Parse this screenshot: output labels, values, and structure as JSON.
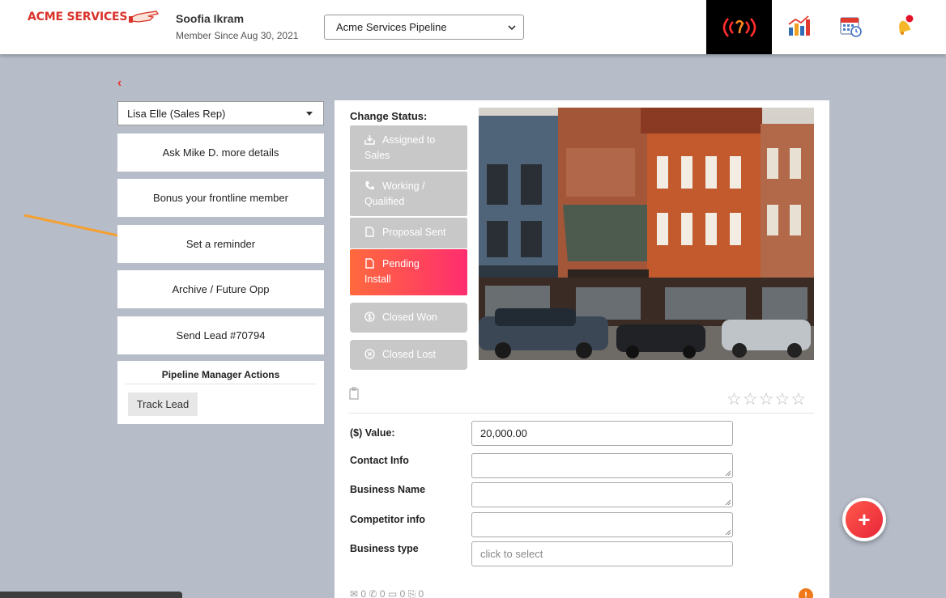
{
  "app": {
    "logo_text": "ACME SERVICES"
  },
  "user": {
    "name": "Soofia Ikram",
    "member_since": "Member Since Aug 30, 2021"
  },
  "pipeline": {
    "selected": "Acme Services Pipeline"
  },
  "header_icons": [
    "live-broadcast-icon",
    "analytics-chart-icon",
    "calendar-icon",
    "notification-bell-icon"
  ],
  "back_label": "‹",
  "rep": {
    "selected": "Lisa Elle (Sales Rep)"
  },
  "actions": [
    "Ask Mike D. more details",
    "Bonus your frontline member",
    "Set a reminder",
    "Archive / Future Opp",
    "Send Lead #70794"
  ],
  "pipeline_manager": {
    "title": "Pipeline Manager Actions",
    "track_label": "Track Lead"
  },
  "status": {
    "title": "Change Status:",
    "options": [
      {
        "line1": "Assigned to",
        "line2": "Sales"
      },
      {
        "line1": "Working /",
        "line2": "Qualified"
      },
      {
        "line1": "Proposal Sent",
        "line2": ""
      },
      {
        "line1": "Pending",
        "line2": "Install"
      },
      {
        "line1": "Closed Won",
        "line2": ""
      },
      {
        "line1": "Closed Lost",
        "line2": ""
      }
    ],
    "active_index": 3
  },
  "rating": {
    "max": 5,
    "value": 0
  },
  "fields": {
    "value_label": "($) Value:",
    "value": "20,000.00",
    "contact_label": "Contact Info",
    "business_name_label": "Business Name",
    "competitor_label": "Competitor info",
    "business_type_label": "Business type",
    "business_type_placeholder": "click to select"
  },
  "counts": {
    "email": "0",
    "call": "0",
    "sms": "0",
    "attach": "0"
  },
  "fab_label": "+",
  "warning_label": "!",
  "colors": {
    "brand": "#d9342b",
    "active_status": "#ff3d5f",
    "inactive_status": "#c8c8c8",
    "arrow": "#f5a030"
  }
}
